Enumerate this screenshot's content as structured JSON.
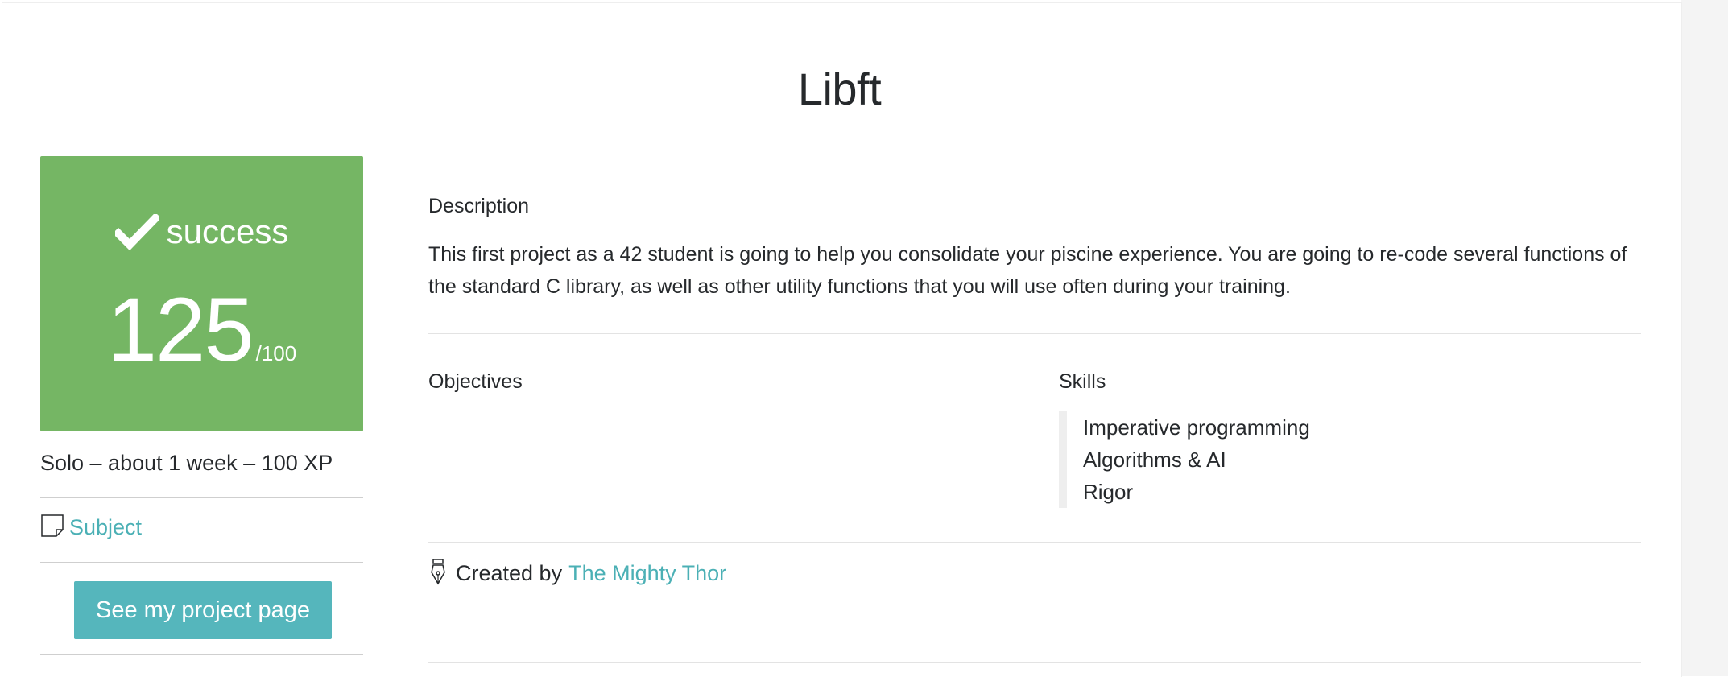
{
  "project": {
    "title": "Libft"
  },
  "status_card": {
    "status": "success",
    "score": "125",
    "score_max": "/100",
    "color": "#75b664"
  },
  "meta": {
    "summary": "Solo – about 1 week – 100 XP"
  },
  "links": {
    "subject_label": "Subject",
    "project_page_button": "See my project page"
  },
  "description": {
    "heading": "Description",
    "text": "This first project as a 42 student is going to help you consolidate your piscine experience. You are going to re-code several functions of the standard C library, as well as other utility functions that you will use often during your training."
  },
  "objectives": {
    "heading": "Objectives"
  },
  "skills": {
    "heading": "Skills",
    "items": [
      "Imperative programming",
      "Algorithms & AI",
      "Rigor"
    ]
  },
  "credits": {
    "created_by_label": "Created by",
    "author": "The Mighty Thor"
  },
  "icons": {
    "check": "check-icon",
    "subject": "note-icon",
    "created": "pen-nib-icon"
  },
  "colors": {
    "accent_link": "#4bb0b5",
    "button": "#55b6bc",
    "success": "#75b664"
  }
}
